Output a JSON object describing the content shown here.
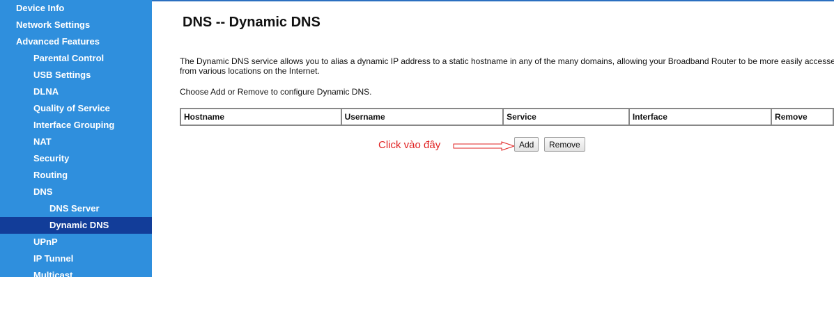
{
  "sidebar": {
    "items": [
      {
        "label": "Device Info",
        "level": 1,
        "active": false
      },
      {
        "label": "Network Settings",
        "level": 1,
        "active": false
      },
      {
        "label": "Advanced Features",
        "level": 1,
        "active": false
      },
      {
        "label": "Parental Control",
        "level": 2,
        "active": false
      },
      {
        "label": "USB Settings",
        "level": 2,
        "active": false
      },
      {
        "label": "DLNA",
        "level": 2,
        "active": false
      },
      {
        "label": "Quality of Service",
        "level": 2,
        "active": false
      },
      {
        "label": "Interface Grouping",
        "level": 2,
        "active": false
      },
      {
        "label": "NAT",
        "level": 2,
        "active": false
      },
      {
        "label": "Security",
        "level": 2,
        "active": false
      },
      {
        "label": "Routing",
        "level": 2,
        "active": false
      },
      {
        "label": "DNS",
        "level": 2,
        "active": false
      },
      {
        "label": "DNS Server",
        "level": 3,
        "active": false
      },
      {
        "label": "Dynamic DNS",
        "level": 3,
        "active": true
      },
      {
        "label": "UPnP",
        "level": 2,
        "active": false
      },
      {
        "label": "IP Tunnel",
        "level": 2,
        "active": false
      },
      {
        "label": "Multicast",
        "level": 2,
        "active": false
      }
    ]
  },
  "main": {
    "title": "DNS -- Dynamic DNS",
    "description": "The Dynamic DNS service allows you to alias a dynamic IP address to a static hostname in any of the many domains, allowing your Broadband Router to be more easily accessed from various locations on the Internet.",
    "hint": "Choose Add or Remove to configure Dynamic DNS.",
    "table": {
      "columns": [
        "Hostname",
        "Username",
        "Service",
        "Interface",
        "Remove"
      ]
    },
    "buttons": {
      "add": "Add",
      "remove": "Remove"
    },
    "annotation": "Click vào đây"
  },
  "colors": {
    "sidebar_bg": "#2f8fdd",
    "sidebar_active": "#123d99",
    "annotation": "#e02020"
  }
}
